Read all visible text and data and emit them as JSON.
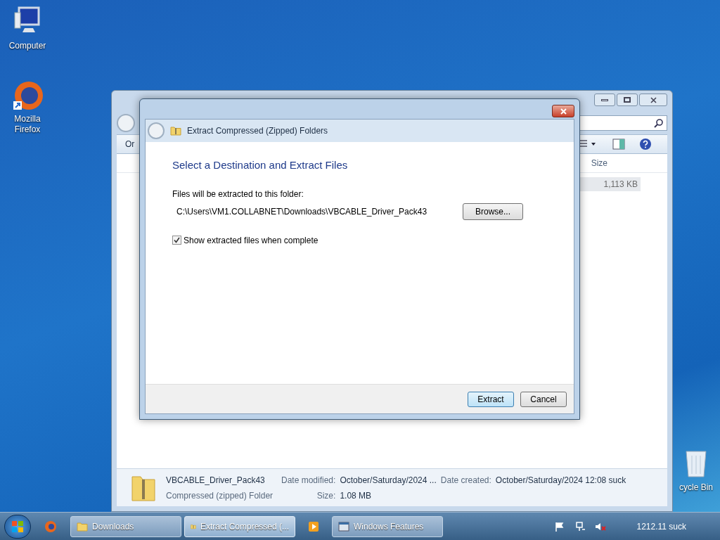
{
  "desktop_icons": [
    {
      "label": "Computer"
    },
    {
      "label": "Mozilla Firefox"
    },
    {
      "label": "cycle Bin"
    }
  ],
  "explorer": {
    "toolbar_button": "Or",
    "column_header": "Size",
    "size_cell": "1,113 KB",
    "details": {
      "name": "VBCABLE_Driver_Pack43",
      "type": "Compressed (zipped) Folder",
      "modified_label": "Date modified:",
      "modified_value": "October/Saturday/2024 ...",
      "created_label": "Date created:",
      "created_value": "October/Saturday/2024 12:08 suck",
      "size_label": "Size:",
      "size_value": "1.08 MB"
    }
  },
  "dialog": {
    "title": "Extract Compressed (Zipped) Folders",
    "heading": "Select a Destination and Extract Files",
    "folder_label": "Files will be extracted to this folder:",
    "path": "C:\\Users\\VM1.COLLABNET\\Downloads\\VBCABLE_Driver_Pack43",
    "browse": "Browse...",
    "checkbox": {
      "label": "Show extracted files when complete",
      "checked": true
    },
    "buttons": [
      {
        "label": "Extract",
        "default": true
      },
      {
        "label": "Cancel",
        "default": false
      }
    ]
  },
  "taskbar": {
    "items": [
      {
        "label": "Downloads",
        "selected": false
      },
      {
        "label": "Extract Compressed (...",
        "selected": true
      },
      {
        "label": "Windows Features",
        "selected": false
      }
    ],
    "clock": "1212.11 suck"
  }
}
